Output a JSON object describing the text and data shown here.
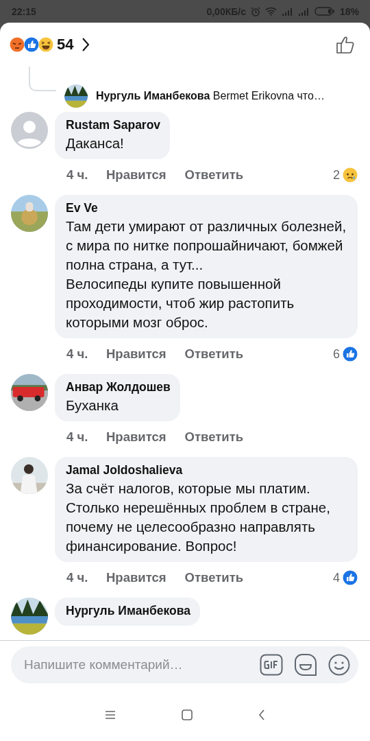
{
  "status_bar": {
    "time": "22:15",
    "speed": "0,00КБ/с",
    "battery": "18%"
  },
  "header": {
    "reaction_count": "54"
  },
  "reply_preview": {
    "author": "Нургуль Иманбекова",
    "text": "Bermet Erikovna что…"
  },
  "comments": [
    {
      "author": "Rustam Saparov",
      "avatar": {
        "kind": "placeholder"
      },
      "text": "Даканса!",
      "time": "4 ч.",
      "like": "Нравится",
      "reply": "Ответить",
      "reaction": {
        "count": "2",
        "kind": "sad"
      }
    },
    {
      "author": "Ev Ve",
      "text": "Там дети умирают от различных болезней, с мира по нитке попрошайничают, бомжей полна страна, а тут...\nВелосипеды купите повышенной проходимости, чтоб жир растопить которыми мозг оброс.",
      "time": "4 ч.",
      "like": "Нравится",
      "reply": "Ответить",
      "reaction": {
        "count": "6",
        "kind": "like"
      }
    },
    {
      "author": "Анвар Жолдошев",
      "text": "Буханка",
      "time": "4 ч.",
      "like": "Нравится",
      "reply": "Ответить"
    },
    {
      "author": "Jamal Joldoshalieva",
      "text": "За счёт налогов, которые мы платим. Столько нерешённых проблем в стране, почему не целесообразно направлять финансирование. Вопрос!",
      "time": "4 ч.",
      "like": "Нравится",
      "reply": "Ответить",
      "reaction": {
        "count": "4",
        "kind": "like"
      }
    },
    {
      "author": "Нургуль Иманбекова"
    }
  ],
  "composer": {
    "placeholder": "Напишите комментарий…"
  }
}
